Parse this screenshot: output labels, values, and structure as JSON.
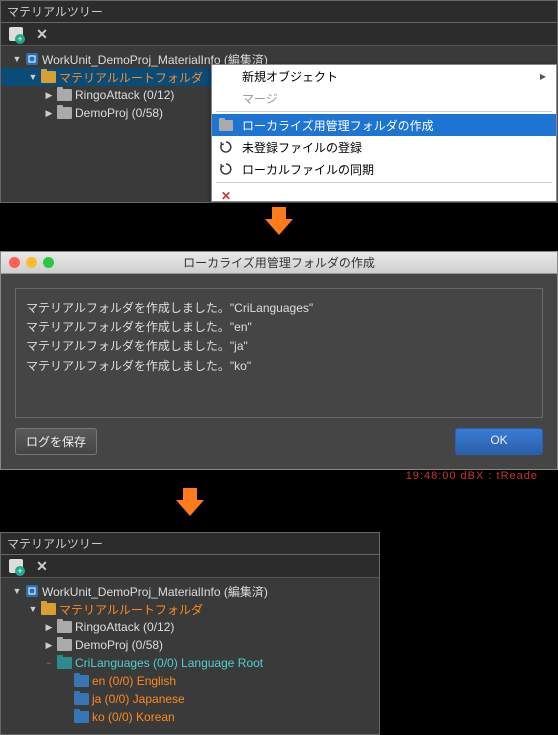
{
  "panel1": {
    "title": "マテリアルツリー",
    "tree": {
      "workunit": "WorkUnit_DemoProj_MaterialInfo (編集済)",
      "root": "マテリアルルートフォルダ",
      "ringo": "RingoAttack (0/12)",
      "demo": "DemoProj (0/58)"
    },
    "menu": {
      "new_object": "新規オブジェクト",
      "merge": "マージ",
      "create_l10n": "ローカライズ用管理フォルダの作成",
      "register": "未登録ファイルの登録",
      "sync": "ローカルファイルの同期"
    }
  },
  "dialog": {
    "title": "ローカライズ用管理フォルダの作成",
    "msg_prefix": "マテリアルフォルダを作成しました。",
    "values": [
      "\"CriLanguages\"",
      "\"en\"",
      "\"ja\"",
      "\"ko\""
    ],
    "btn_save_log": "ログを保存",
    "btn_ok": "OK"
  },
  "under_text": "19:48:00 dBX : tReade",
  "panel3": {
    "title": "マテリアルツリー",
    "tree": {
      "workunit": "WorkUnit_DemoProj_MaterialInfo (編集済)",
      "root": "マテリアルルートフォルダ",
      "ringo": "RingoAttack (0/12)",
      "demo": "DemoProj (0/58)",
      "crilang": "CriLanguages (0/0) Language Root",
      "en": "en (0/0) English",
      "ja": "ja (0/0) Japanese",
      "ko": "ko (0/0) Korean"
    }
  }
}
